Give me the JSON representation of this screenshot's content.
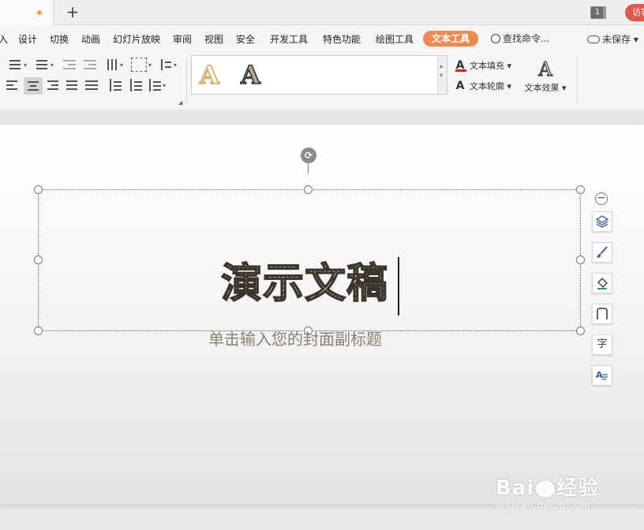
{
  "tabs": {
    "new_tab": "+",
    "window_count": "1",
    "visit": "访客"
  },
  "menu": {
    "items": [
      "入",
      "设计",
      "切换",
      "动画",
      "幻灯片放映",
      "审阅",
      "视图",
      "安全",
      "开发工具",
      "特色功能",
      "绘图工具"
    ],
    "active": "文本工具",
    "search": "查找命令...",
    "save_state": "未保存"
  },
  "ribbon": {
    "text_fill": "文本填充",
    "text_outline": "文本轮廓",
    "text_effect": "文本效果",
    "style_glyph": "A",
    "effect_glyph": "A",
    "colors": {
      "accent": "#f28a4f",
      "fill": "#d62020"
    }
  },
  "slide": {
    "title": "演示文稿",
    "subtitle": "单击输入您的封面副标题"
  },
  "float_toolbar": {
    "icons": [
      "collapse-icon",
      "layers-icon",
      "brush-icon",
      "fill-icon",
      "border-icon",
      "char-icon",
      "text-edit-icon"
    ],
    "char_glyph": "字"
  },
  "watermark": {
    "logo_left": "Bai",
    "logo_right": "经验",
    "url": "jingyan.baidu.com"
  }
}
